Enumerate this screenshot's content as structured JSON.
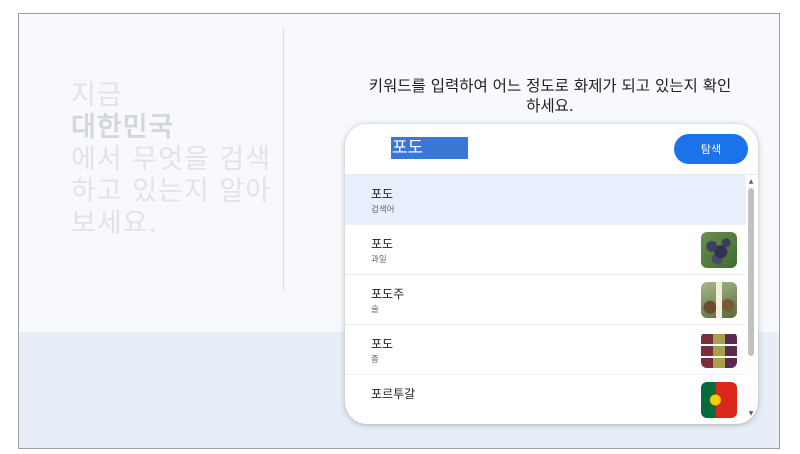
{
  "headline": {
    "line1": "지금",
    "region": "대한민국",
    "line3": "에서 무엇을 검색",
    "line4": "하고 있는지 알아",
    "line5": "보세요."
  },
  "instruction": {
    "line1": "키워드를 입력하여 어느 정도로 화제가 되고 있는지 확인",
    "line2": "하세요."
  },
  "search": {
    "value": "포도",
    "button_label": "탐색"
  },
  "results": [
    {
      "title": "포도",
      "subtitle": "검색어",
      "thumb": null,
      "selected": true
    },
    {
      "title": "포도",
      "subtitle": "과일",
      "thumb": "grapes-thumbnail"
    },
    {
      "title": "포도주",
      "subtitle": "술",
      "thumb": "wine-thumbnail"
    },
    {
      "title": "포도",
      "subtitle": "종",
      "thumb": "grape-varieties-thumbnail"
    },
    {
      "title": "포르투갈",
      "subtitle": "",
      "thumb": "portugal-flag-thumbnail"
    }
  ],
  "colors": {
    "accent": "#1a73e8",
    "selected_row": "#e8f0fe",
    "selection_highlight": "#3a78d8"
  },
  "icons": {
    "scroll_up": "scroll-up-arrow-icon",
    "scroll_down": "scroll-down-arrow-icon"
  }
}
